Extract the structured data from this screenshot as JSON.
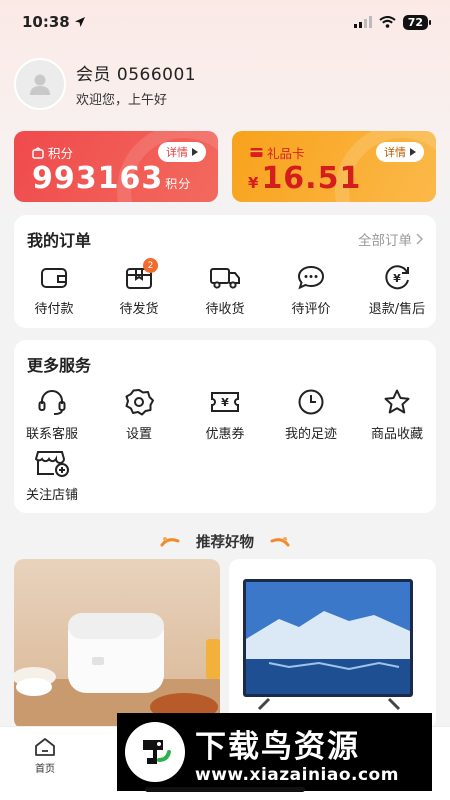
{
  "status_bar": {
    "time": "10:38",
    "battery": "72"
  },
  "profile": {
    "name": "会员 0566001",
    "greeting": "欢迎您，上午好"
  },
  "cards": {
    "points": {
      "label": "积分",
      "detail": "详情",
      "value": "993163",
      "unit": "积分"
    },
    "gift_card": {
      "label": "礼品卡",
      "detail": "详情",
      "currency": "¥",
      "value": "16.51"
    }
  },
  "orders": {
    "title": "我的订单",
    "all_link": "全部订单",
    "items": [
      {
        "label": "待付款",
        "icon": "wallet-icon"
      },
      {
        "label": "待发货",
        "icon": "package-icon",
        "badge": "2"
      },
      {
        "label": "待收货",
        "icon": "truck-icon"
      },
      {
        "label": "待评价",
        "icon": "comment-icon"
      },
      {
        "label": "退款/售后",
        "icon": "refund-icon"
      }
    ]
  },
  "services": {
    "title": "更多服务",
    "items": [
      {
        "label": "联系客服",
        "icon": "headset-icon"
      },
      {
        "label": "设置",
        "icon": "gear-icon"
      },
      {
        "label": "优惠券",
        "icon": "coupon-icon"
      },
      {
        "label": "我的足迹",
        "icon": "clock-icon"
      },
      {
        "label": "商品收藏",
        "icon": "star-icon"
      },
      {
        "label": "关注店铺",
        "icon": "store-icon"
      }
    ]
  },
  "recommend": {
    "title": "推荐好物"
  },
  "tabbar": {
    "home": "首页"
  },
  "watermark": {
    "text": "下载鸟资源",
    "url": "www.xiazainiao.com"
  },
  "colors": {
    "accent_red": "#f04a4c",
    "accent_orange": "#f8a21b",
    "badge": "#f36a2d"
  }
}
